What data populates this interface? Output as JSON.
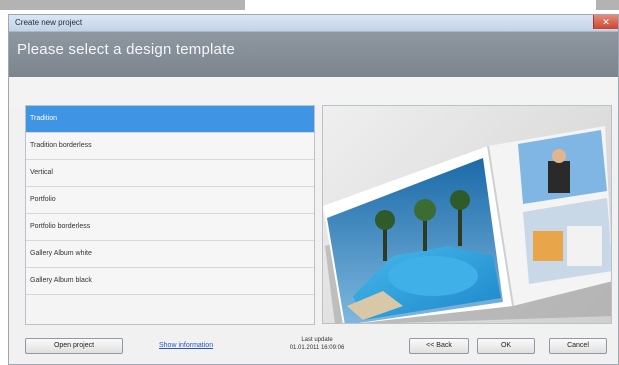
{
  "window": {
    "title": "Create new project",
    "close_icon": "close-icon"
  },
  "banner": {
    "heading": "Please select a design template"
  },
  "templates": {
    "items": [
      {
        "label": "Tradition",
        "selected": true
      },
      {
        "label": "Tradition borderless",
        "selected": false
      },
      {
        "label": "Vertical",
        "selected": false
      },
      {
        "label": "Portfolio",
        "selected": false
      },
      {
        "label": "Portfolio borderless",
        "selected": false
      },
      {
        "label": "Gallery Album white",
        "selected": false
      },
      {
        "label": "Gallery Album black",
        "selected": false
      }
    ]
  },
  "footer": {
    "open_project_label": "Open project",
    "info_link_label": "Show information",
    "last_update_label": "Last update",
    "last_update_value": "01.01.2011 16:09:06",
    "back_label": "<< Back",
    "ok_label": "OK",
    "cancel_label": "Cancel"
  },
  "colors": {
    "selected_item": "#3f95e4",
    "banner": "#858d97",
    "close_button": "#d05a45"
  }
}
